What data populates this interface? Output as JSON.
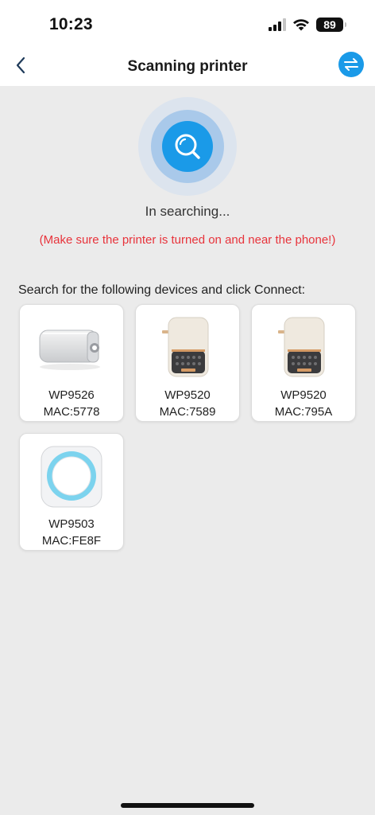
{
  "status_bar": {
    "time": "10:23",
    "battery": "89"
  },
  "header": {
    "title": "Scanning printer"
  },
  "scan": {
    "status": "In searching...",
    "hint": "(Make sure the printer is turned on and near the phone!)"
  },
  "devices": {
    "heading": "Search for the following devices and click Connect:",
    "items": [
      {
        "model": "WP9526",
        "mac": "MAC:5778",
        "icon": "bar-printer"
      },
      {
        "model": "WP9520",
        "mac": "MAC:7589",
        "icon": "label-printer"
      },
      {
        "model": "WP9520",
        "mac": "MAC:795A",
        "icon": "label-printer"
      },
      {
        "model": "WP9503",
        "mac": "MAC:FE8F",
        "icon": "pocket-printer"
      }
    ]
  },
  "colors": {
    "accent": "#1a9ae8",
    "warning": "#e8333b",
    "background": "#ebebeb"
  }
}
